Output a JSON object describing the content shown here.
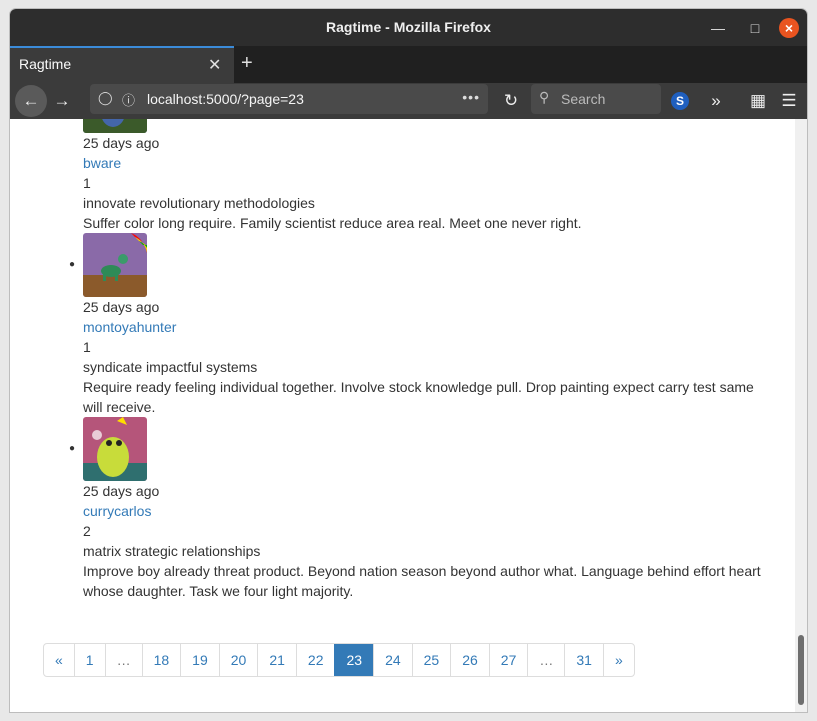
{
  "window": {
    "title": "Ragtime - Mozilla Firefox"
  },
  "tabs": [
    {
      "label": "Ragtime"
    }
  ],
  "navbar": {
    "url": "localhost:5000/?page=23",
    "search_placeholder": "Search"
  },
  "posts": [
    {
      "time": "25 days ago",
      "user": "bware",
      "score": "1",
      "title": "innovate revolutionary methodologies",
      "body": "Suffer color long require. Family scientist reduce area real. Meet one never right."
    },
    {
      "time": "25 days ago",
      "user": "montoyahunter",
      "score": "1",
      "title": "syndicate impactful systems",
      "body": "Require ready feeling individual together. Involve stock knowledge pull. Drop painting expect carry test same will receive."
    },
    {
      "time": "25 days ago",
      "user": "currycarlos",
      "score": "2",
      "title": "matrix strategic relationships",
      "body": "Improve boy already threat product. Beyond nation season beyond author what. Language behind effort heart whose daughter. Task we four light majority."
    }
  ],
  "pagination": {
    "items": [
      "«",
      "1",
      "…",
      "18",
      "19",
      "20",
      "21",
      "22",
      "23",
      "24",
      "25",
      "26",
      "27",
      "…",
      "31",
      "»"
    ],
    "active": "23"
  },
  "colors": {
    "link": "#337ab7",
    "tab_accent": "#3b8bd9",
    "close_button": "#e95420"
  }
}
